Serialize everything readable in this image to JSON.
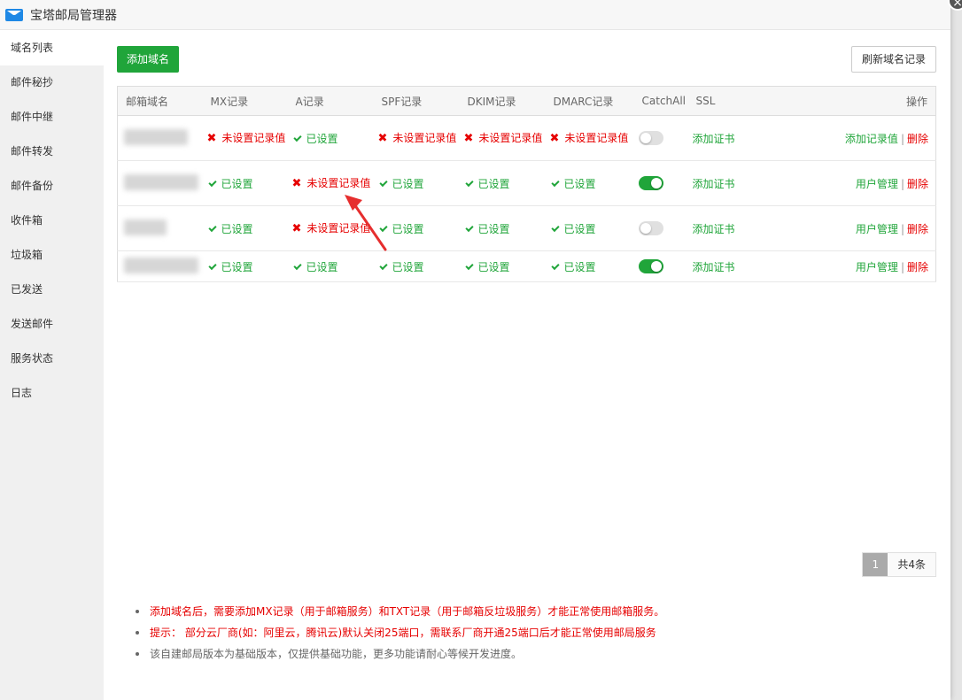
{
  "window": {
    "title": "宝塔邮局管理器"
  },
  "sidebar": {
    "items": [
      {
        "label": "域名列表",
        "active": true
      },
      {
        "label": "邮件秘抄"
      },
      {
        "label": "邮件中继"
      },
      {
        "label": "邮件转发"
      },
      {
        "label": "邮件备份"
      },
      {
        "label": "收件箱"
      },
      {
        "label": "垃圾箱"
      },
      {
        "label": "已发送"
      },
      {
        "label": "发送邮件"
      },
      {
        "label": "服务状态"
      },
      {
        "label": "日志"
      }
    ]
  },
  "toolbar": {
    "add_label": "添加域名",
    "refresh_label": "刷新域名记录"
  },
  "table": {
    "headers": [
      "邮箱域名",
      "MX记录",
      "A记录",
      "SPF记录",
      "DKIM记录",
      "DMARC记录",
      "CatchAll",
      "SSL",
      "操作"
    ],
    "status_set": "已设置",
    "status_unset": "未设置记录值",
    "rows": [
      {
        "mx": false,
        "a": true,
        "spf": false,
        "dkim": false,
        "dmarc": false,
        "catchall": false,
        "ssl": "添加证书",
        "op1": "添加记录值",
        "op2": "删除"
      },
      {
        "mx": true,
        "a": false,
        "spf": true,
        "dkim": true,
        "dmarc": true,
        "catchall": true,
        "ssl": "添加证书",
        "op1": "用户管理",
        "op2": "删除"
      },
      {
        "mx": true,
        "a": false,
        "spf": true,
        "dkim": true,
        "dmarc": true,
        "catchall": false,
        "ssl": "添加证书",
        "op1": "用户管理",
        "op2": "删除"
      },
      {
        "mx": true,
        "a": true,
        "spf": true,
        "dkim": true,
        "dmarc": true,
        "catchall": true,
        "ssl": "添加证书",
        "op1": "用户管理",
        "op2": "删除"
      }
    ]
  },
  "pager": {
    "current": "1",
    "total": "共4条"
  },
  "notes": [
    {
      "text": "添加域名后，需要添加MX记录（用于邮箱服务）和TXT记录（用于邮箱反垃圾服务）才能正常使用邮箱服务。",
      "color": "red"
    },
    {
      "text": "提示： 部分云厂商(如：阿里云，腾讯云)默认关闭25端口，需联系厂商开通25端口后才能正常使用邮局服务",
      "color": "red"
    },
    {
      "text": "该自建邮局版本为基础版本，仅提供基础功能，更多功能请耐心等候开发进度。",
      "color": "gray"
    }
  ],
  "colors": {
    "green": "#20a53a",
    "red": "#e60000"
  }
}
